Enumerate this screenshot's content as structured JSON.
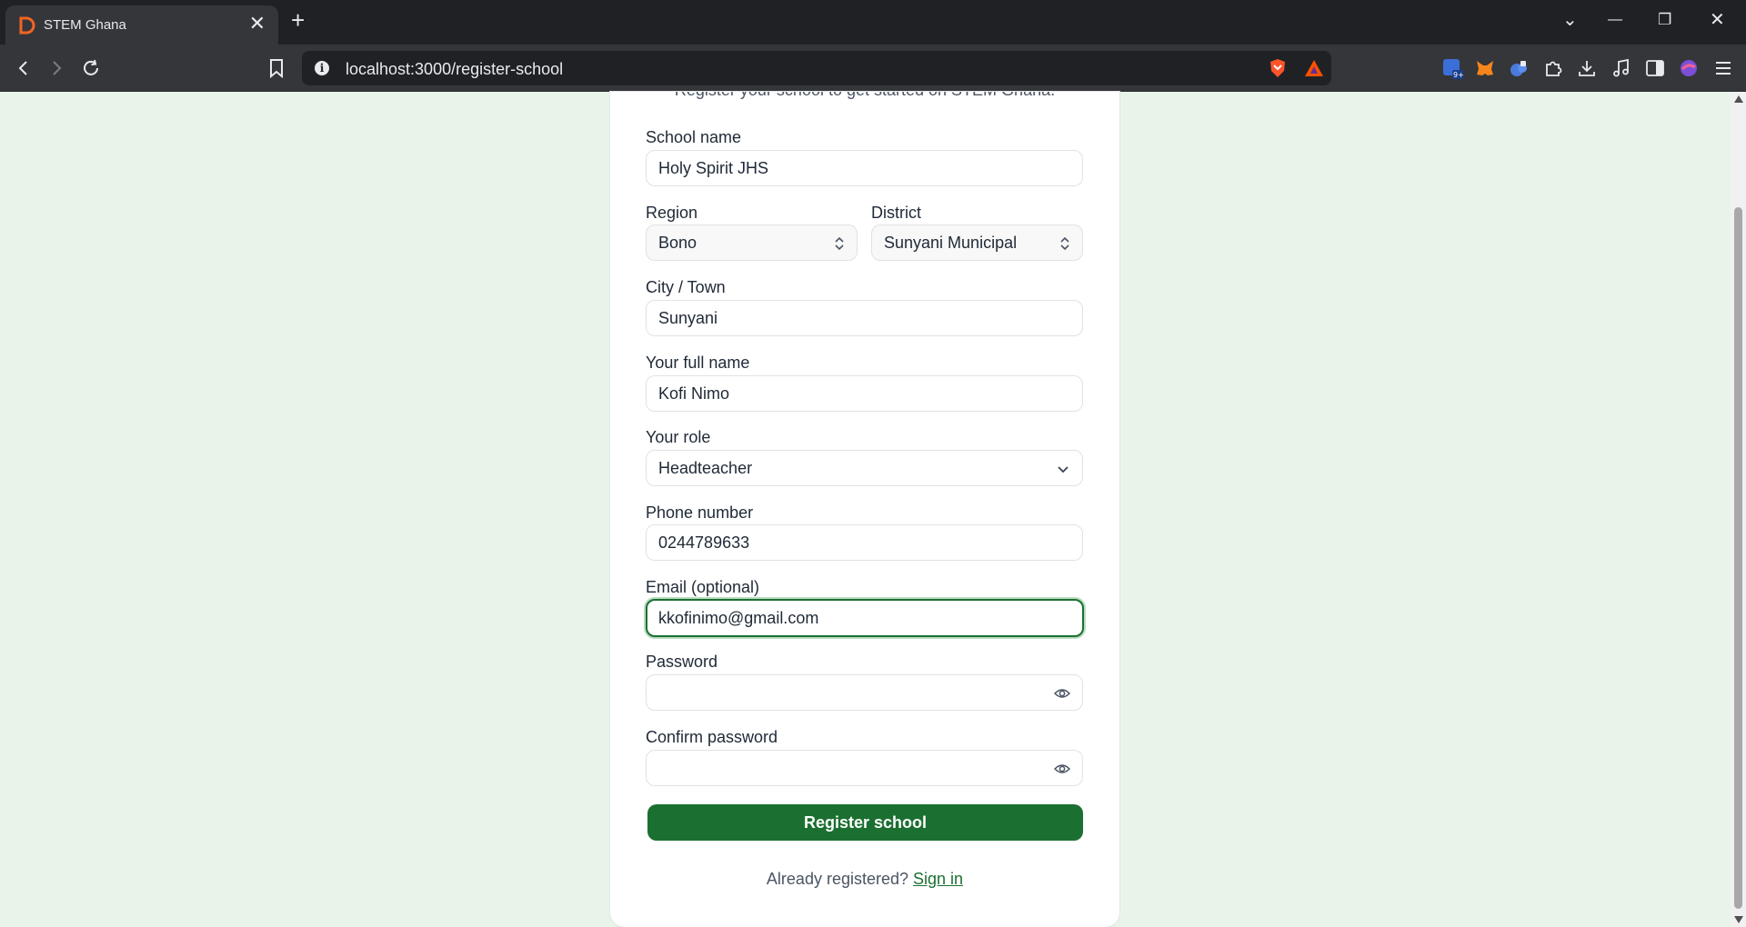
{
  "browser": {
    "tab_title": "STEM Ghana",
    "tab_close": "✕",
    "new_tab": "+",
    "url": "localhost:3000/register-school",
    "window_controls": {
      "list": "⌄",
      "minimize": "—",
      "restore": "❐",
      "close": "✕"
    }
  },
  "form": {
    "subtitle": "Register your school to get started on STEM Ghana.",
    "school_name": {
      "label": "School name",
      "value": "Holy Spirit JHS"
    },
    "region": {
      "label": "Region",
      "value": "Bono"
    },
    "district": {
      "label": "District",
      "value": "Sunyani Municipal"
    },
    "city": {
      "label": "City / Town",
      "value": "Sunyani"
    },
    "full_name": {
      "label": "Your full name",
      "value": "Kofi Nimo"
    },
    "role": {
      "label": "Your role",
      "value": "Headteacher"
    },
    "phone": {
      "label": "Phone number",
      "value": "0244789633"
    },
    "email": {
      "label": "Email (optional)",
      "value": "kkofinimo@gmail.com"
    },
    "password": {
      "label": "Password",
      "value": ""
    },
    "confirm_password": {
      "label": "Confirm password",
      "value": ""
    },
    "submit_label": "Register school",
    "footer_text": "Already registered?",
    "signin_link": "Sign in"
  },
  "colors": {
    "accent": "#1b7031",
    "page_background": "#e8f4ea",
    "card_background": "#ffffff"
  }
}
